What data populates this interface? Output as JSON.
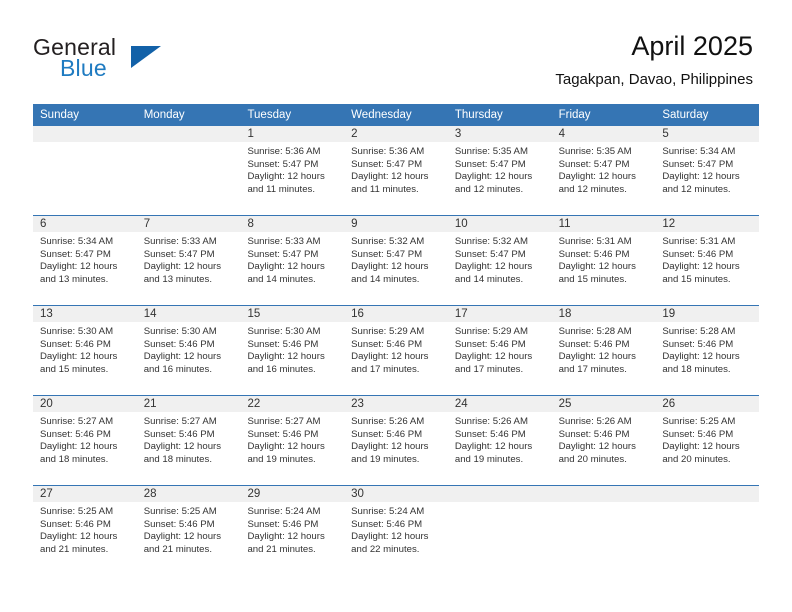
{
  "brand": {
    "name_primary": "General",
    "name_secondary": "Blue",
    "triangle_icon": "triangle-icon",
    "primary_color": "#231f20",
    "secondary_color": "#1f7bc1",
    "triangle_color": "#1261a8"
  },
  "header": {
    "title": "April 2025",
    "subtitle": "Tagakpan, Davao, Philippines"
  },
  "theme": {
    "header_bar_color": "#3575b4",
    "day_strip_color": "#f0f0f0",
    "divider_color": "#3575b4",
    "text_color": "#333333"
  },
  "weekdays": [
    "Sunday",
    "Monday",
    "Tuesday",
    "Wednesday",
    "Thursday",
    "Friday",
    "Saturday"
  ],
  "weeks": [
    [
      {
        "day": "",
        "sunrise": "",
        "sunset": "",
        "daylight": ""
      },
      {
        "day": "",
        "sunrise": "",
        "sunset": "",
        "daylight": ""
      },
      {
        "day": "1",
        "sunrise": "Sunrise: 5:36 AM",
        "sunset": "Sunset: 5:47 PM",
        "daylight": "Daylight: 12 hours and 11 minutes."
      },
      {
        "day": "2",
        "sunrise": "Sunrise: 5:36 AM",
        "sunset": "Sunset: 5:47 PM",
        "daylight": "Daylight: 12 hours and 11 minutes."
      },
      {
        "day": "3",
        "sunrise": "Sunrise: 5:35 AM",
        "sunset": "Sunset: 5:47 PM",
        "daylight": "Daylight: 12 hours and 12 minutes."
      },
      {
        "day": "4",
        "sunrise": "Sunrise: 5:35 AM",
        "sunset": "Sunset: 5:47 PM",
        "daylight": "Daylight: 12 hours and 12 minutes."
      },
      {
        "day": "5",
        "sunrise": "Sunrise: 5:34 AM",
        "sunset": "Sunset: 5:47 PM",
        "daylight": "Daylight: 12 hours and 12 minutes."
      }
    ],
    [
      {
        "day": "6",
        "sunrise": "Sunrise: 5:34 AM",
        "sunset": "Sunset: 5:47 PM",
        "daylight": "Daylight: 12 hours and 13 minutes."
      },
      {
        "day": "7",
        "sunrise": "Sunrise: 5:33 AM",
        "sunset": "Sunset: 5:47 PM",
        "daylight": "Daylight: 12 hours and 13 minutes."
      },
      {
        "day": "8",
        "sunrise": "Sunrise: 5:33 AM",
        "sunset": "Sunset: 5:47 PM",
        "daylight": "Daylight: 12 hours and 14 minutes."
      },
      {
        "day": "9",
        "sunrise": "Sunrise: 5:32 AM",
        "sunset": "Sunset: 5:47 PM",
        "daylight": "Daylight: 12 hours and 14 minutes."
      },
      {
        "day": "10",
        "sunrise": "Sunrise: 5:32 AM",
        "sunset": "Sunset: 5:47 PM",
        "daylight": "Daylight: 12 hours and 14 minutes."
      },
      {
        "day": "11",
        "sunrise": "Sunrise: 5:31 AM",
        "sunset": "Sunset: 5:46 PM",
        "daylight": "Daylight: 12 hours and 15 minutes."
      },
      {
        "day": "12",
        "sunrise": "Sunrise: 5:31 AM",
        "sunset": "Sunset: 5:46 PM",
        "daylight": "Daylight: 12 hours and 15 minutes."
      }
    ],
    [
      {
        "day": "13",
        "sunrise": "Sunrise: 5:30 AM",
        "sunset": "Sunset: 5:46 PM",
        "daylight": "Daylight: 12 hours and 15 minutes."
      },
      {
        "day": "14",
        "sunrise": "Sunrise: 5:30 AM",
        "sunset": "Sunset: 5:46 PM",
        "daylight": "Daylight: 12 hours and 16 minutes."
      },
      {
        "day": "15",
        "sunrise": "Sunrise: 5:30 AM",
        "sunset": "Sunset: 5:46 PM",
        "daylight": "Daylight: 12 hours and 16 minutes."
      },
      {
        "day": "16",
        "sunrise": "Sunrise: 5:29 AM",
        "sunset": "Sunset: 5:46 PM",
        "daylight": "Daylight: 12 hours and 17 minutes."
      },
      {
        "day": "17",
        "sunrise": "Sunrise: 5:29 AM",
        "sunset": "Sunset: 5:46 PM",
        "daylight": "Daylight: 12 hours and 17 minutes."
      },
      {
        "day": "18",
        "sunrise": "Sunrise: 5:28 AM",
        "sunset": "Sunset: 5:46 PM",
        "daylight": "Daylight: 12 hours and 17 minutes."
      },
      {
        "day": "19",
        "sunrise": "Sunrise: 5:28 AM",
        "sunset": "Sunset: 5:46 PM",
        "daylight": "Daylight: 12 hours and 18 minutes."
      }
    ],
    [
      {
        "day": "20",
        "sunrise": "Sunrise: 5:27 AM",
        "sunset": "Sunset: 5:46 PM",
        "daylight": "Daylight: 12 hours and 18 minutes."
      },
      {
        "day": "21",
        "sunrise": "Sunrise: 5:27 AM",
        "sunset": "Sunset: 5:46 PM",
        "daylight": "Daylight: 12 hours and 18 minutes."
      },
      {
        "day": "22",
        "sunrise": "Sunrise: 5:27 AM",
        "sunset": "Sunset: 5:46 PM",
        "daylight": "Daylight: 12 hours and 19 minutes."
      },
      {
        "day": "23",
        "sunrise": "Sunrise: 5:26 AM",
        "sunset": "Sunset: 5:46 PM",
        "daylight": "Daylight: 12 hours and 19 minutes."
      },
      {
        "day": "24",
        "sunrise": "Sunrise: 5:26 AM",
        "sunset": "Sunset: 5:46 PM",
        "daylight": "Daylight: 12 hours and 19 minutes."
      },
      {
        "day": "25",
        "sunrise": "Sunrise: 5:26 AM",
        "sunset": "Sunset: 5:46 PM",
        "daylight": "Daylight: 12 hours and 20 minutes."
      },
      {
        "day": "26",
        "sunrise": "Sunrise: 5:25 AM",
        "sunset": "Sunset: 5:46 PM",
        "daylight": "Daylight: 12 hours and 20 minutes."
      }
    ],
    [
      {
        "day": "27",
        "sunrise": "Sunrise: 5:25 AM",
        "sunset": "Sunset: 5:46 PM",
        "daylight": "Daylight: 12 hours and 21 minutes."
      },
      {
        "day": "28",
        "sunrise": "Sunrise: 5:25 AM",
        "sunset": "Sunset: 5:46 PM",
        "daylight": "Daylight: 12 hours and 21 minutes."
      },
      {
        "day": "29",
        "sunrise": "Sunrise: 5:24 AM",
        "sunset": "Sunset: 5:46 PM",
        "daylight": "Daylight: 12 hours and 21 minutes."
      },
      {
        "day": "30",
        "sunrise": "Sunrise: 5:24 AM",
        "sunset": "Sunset: 5:46 PM",
        "daylight": "Daylight: 12 hours and 22 minutes."
      },
      {
        "day": "",
        "sunrise": "",
        "sunset": "",
        "daylight": ""
      },
      {
        "day": "",
        "sunrise": "",
        "sunset": "",
        "daylight": ""
      },
      {
        "day": "",
        "sunrise": "",
        "sunset": "",
        "daylight": ""
      }
    ]
  ]
}
